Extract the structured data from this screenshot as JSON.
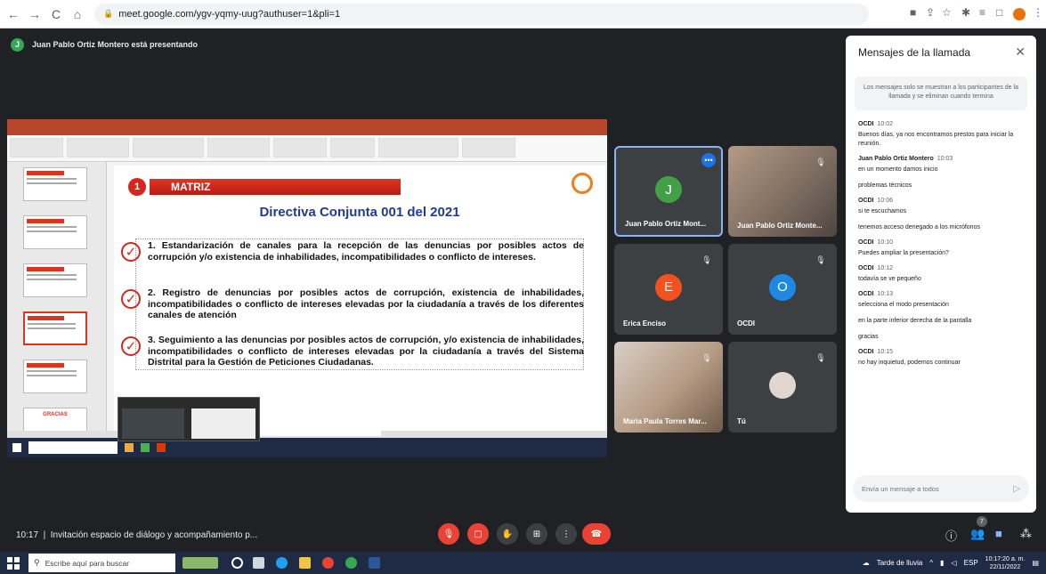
{
  "browser": {
    "url": "meet.google.com/ygv-yqmy-uug?authuser=1&pli=1"
  },
  "meeting": {
    "presenter_initial": "J",
    "presenter_banner": "Juan Pablo Ortiz Montero está presentando",
    "time": "10:17",
    "title": "Invitación espacio de diálogo y acompañamiento p...",
    "participants_count": "7"
  },
  "slide": {
    "number": "1",
    "heading": "MATRIZ",
    "title": "Directiva Conjunta 001 del 2021",
    "items": [
      "1. Estandarización de canales para la recepción de las denuncias por posibles actos de corrupción y/o existencia de inhabilidades, incompatibilidades o conflicto de intereses.",
      "2. Registro de denuncias por posibles actos de corrupción, existencia de inhabilidades, incompatibilidades o conflicto de intereses elevadas por la ciudadanía a través de los diferentes canales de atención",
      "3. Seguimiento a las denuncias por posibles actos de corrupción, y/o existencia de inhabilidades, incompatibilidades o conflicto de intereses elevadas por la ciudadanía a través del Sistema Distrital para la Gestión de Peticiones Ciudadanas."
    ],
    "thumb_last": "GRACIAS"
  },
  "tiles": [
    {
      "name": "Juan Pablo Ortiz Mont...",
      "initial": "J",
      "color": "#43a047"
    },
    {
      "name": "Juan Pablo Ortiz Monte..."
    },
    {
      "name": "Erica Enciso",
      "initial": "E",
      "color": "#f4511e"
    },
    {
      "name": "OCDI",
      "initial": "O",
      "color": "#1e88e5"
    },
    {
      "name": "Maria Paula Torres Mar..."
    },
    {
      "name": "Tú"
    }
  ],
  "chat": {
    "title": "Mensajes de la llamada",
    "notice": "Los mensajes solo se muestran a los participantes de la llamada y se eliminan cuando termina",
    "placeholder": "Envía un mensaje a todos",
    "messages": [
      {
        "sender": "OCDI",
        "time": "10:02",
        "lines": [
          "Buenos días, ya nos encontramos prestos para iniciar la reunión."
        ]
      },
      {
        "sender": "Juan Pablo Ortiz Montero",
        "time": "10:03",
        "lines": [
          "en un momento damos inicio",
          "problemas técnicos"
        ]
      },
      {
        "sender": "OCDI",
        "time": "10:06",
        "lines": [
          "si te escuchamos",
          "tenemos acceso denegado a los micrófonos"
        ]
      },
      {
        "sender": "OCDI",
        "time": "10:10",
        "lines": [
          "Puedes ampliar la presentación?"
        ]
      },
      {
        "sender": "OCDI",
        "time": "10:12",
        "lines": [
          "todavía se ve pequeño"
        ]
      },
      {
        "sender": "OCDI",
        "time": "10:13",
        "lines": [
          "selecciona el modo presentación",
          "en la parte inferior derecha de la pantalla",
          "gracias"
        ]
      },
      {
        "sender": "OCDI",
        "time": "10:15",
        "lines": [
          "no hay inquietud, podemos continuar"
        ]
      }
    ]
  },
  "taskbar": {
    "search": "Escribe aquí para buscar",
    "weather": "Tarde de lluvia",
    "lang": "ESP",
    "clock_time": "10:17:20 a. m.",
    "clock_date": "22/11/2022"
  }
}
